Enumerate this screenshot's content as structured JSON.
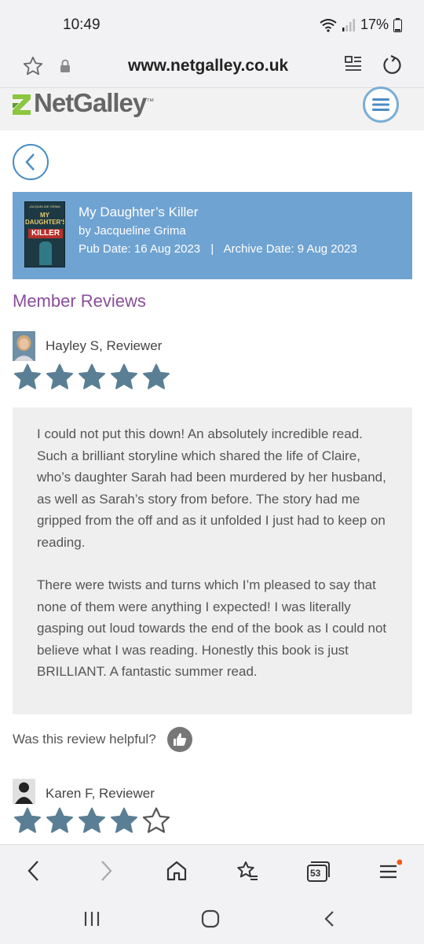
{
  "status": {
    "time": "10:49",
    "battery": "17%"
  },
  "browser": {
    "url": "www.netgalley.co.uk",
    "tab_count": "53"
  },
  "site": {
    "logo_text": "NetGalley",
    "logo_tm": "™"
  },
  "book": {
    "cover_author": "JACQUELINE GRIMA",
    "cover_title_top": "MY",
    "cover_title_mid": "DAUGHTER'S",
    "cover_title_bottom": "KILLER",
    "title": "My Daughter’s Killer",
    "author": "by Jacqueline Grima",
    "pub_date": "Pub Date: 16 Aug 2023",
    "separator": "|",
    "archive_date": "Archive Date: 9 Aug 2023"
  },
  "section_title": "Member Reviews",
  "reviews": [
    {
      "reviewer": "Hayley S, Reviewer",
      "rating": 5,
      "paragraphs": [
        "I could not put this down! An absolutely incredible read. Such a brilliant storyline which shared the life of Claire, who’s daughter Sarah had been murdered by her husband, as well as Sarah’s story from before. The story had me gripped from the off and as it unfolded I just had to keep on reading.",
        "There were twists and turns which I’m pleased to say that none of them were anything I expected! I was literally gasping out loud towards the end of the book as I could not believe what I was reading. Honestly this book is just BRILLIANT. A fantastic summer read."
      ],
      "helpful_question": "Was this review helpful?"
    },
    {
      "reviewer": "Karen F, Reviewer",
      "rating": 4
    }
  ],
  "colors": {
    "accent_blue": "#6fa3d2",
    "star_fill": "#5a7f95",
    "section_purple": "#8a4d9a"
  }
}
